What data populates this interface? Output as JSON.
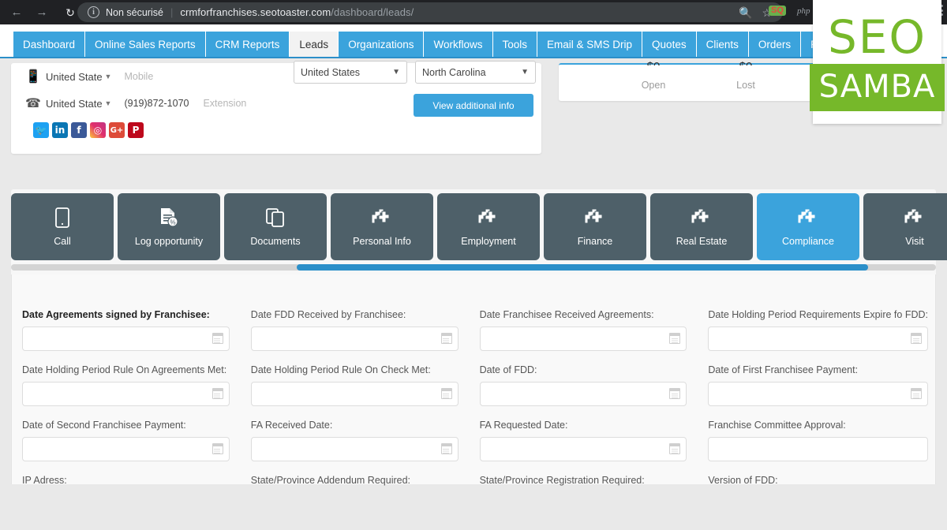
{
  "browser": {
    "back_icon": "back-arrow-icon",
    "forward_icon": "forward-arrow-icon",
    "reload_icon": "reload-icon",
    "security_label": "Non sécurisé",
    "url_host": "crmforfranchises.seotoaster.com",
    "url_path": "/dashboard/leads/",
    "search_icon": "search-icon",
    "bookmark_icon": "star-icon",
    "extension_badge": "SQ",
    "extension_php": "php",
    "menu_icon": "kebab-menu-icon"
  },
  "appnav": {
    "items": [
      {
        "label": "Dashboard",
        "active": false
      },
      {
        "label": "Online Sales Reports",
        "active": false
      },
      {
        "label": "CRM Reports",
        "active": false
      },
      {
        "label": "Leads",
        "active": true
      },
      {
        "label": "Organizations",
        "active": false
      },
      {
        "label": "Workflows",
        "active": false
      },
      {
        "label": "Tools",
        "active": false
      },
      {
        "label": "Email & SMS Drip",
        "active": false
      },
      {
        "label": "Quotes",
        "active": false
      },
      {
        "label": "Clients",
        "active": false
      },
      {
        "label": "Orders",
        "active": false
      },
      {
        "label": "Products",
        "active": false
      }
    ]
  },
  "contact": {
    "mobile_row": {
      "icon": "mobile-phone-icon",
      "country": "United State",
      "placeholder": "Mobile"
    },
    "phone_row": {
      "icon": "telephone-icon",
      "country": "United State",
      "number": "(919)872-1070",
      "extension_placeholder": "Extension"
    },
    "social": [
      {
        "name": "twitter-icon",
        "glyph": "🐦"
      },
      {
        "name": "linkedin-icon",
        "glyph": "in"
      },
      {
        "name": "facebook-icon",
        "glyph": "f"
      },
      {
        "name": "instagram-icon",
        "glyph": "◎"
      },
      {
        "name": "googleplus-icon",
        "glyph": "G+"
      },
      {
        "name": "pinterest-icon",
        "glyph": "P"
      }
    ]
  },
  "location": {
    "country": "United States",
    "state": "North Carolina",
    "view_additional_info": "View additional info"
  },
  "stats": {
    "open_label": "Open",
    "lost_label": "Lost"
  },
  "module_tabs": [
    {
      "label": "Call",
      "icon": "mobile-device-icon",
      "active": false
    },
    {
      "label": "Log opportunity",
      "icon": "document-percent-icon",
      "active": false
    },
    {
      "label": "Documents",
      "icon": "copy-documents-icon",
      "active": false
    },
    {
      "label": "Personal Info",
      "icon": "broken-image-icon",
      "active": false
    },
    {
      "label": "Employment",
      "icon": "broken-image-icon",
      "active": false
    },
    {
      "label": "Finance",
      "icon": "broken-image-icon",
      "active": false
    },
    {
      "label": "Real Estate",
      "icon": "broken-image-icon",
      "active": false
    },
    {
      "label": "Compliance",
      "icon": "broken-image-icon",
      "active": true
    },
    {
      "label": "Visit",
      "icon": "broken-image-icon",
      "active": false
    }
  ],
  "form_fields": [
    {
      "label": "Date Agreements signed by Franchisee:",
      "value": "",
      "calendar": true,
      "bold": true
    },
    {
      "label": "Date FDD Received by Franchisee:",
      "value": "",
      "calendar": true,
      "bold": false
    },
    {
      "label": "Date Franchisee Received Agreements:",
      "value": "",
      "calendar": true,
      "bold": false
    },
    {
      "label": "Date Holding Period Requirements Expire fo FDD:",
      "value": "",
      "calendar": true,
      "bold": false
    },
    {
      "label": "Date Holding Period Rule On Agreements Met:",
      "value": "",
      "calendar": true,
      "bold": false
    },
    {
      "label": "Date Holding Period Rule On Check Met:",
      "value": "",
      "calendar": true,
      "bold": false
    },
    {
      "label": "Date of FDD:",
      "value": "",
      "calendar": true,
      "bold": false
    },
    {
      "label": "Date of First Franchisee Payment:",
      "value": "",
      "calendar": true,
      "bold": false
    },
    {
      "label": "Date of Second Franchisee Payment:",
      "value": "",
      "calendar": true,
      "bold": false
    },
    {
      "label": "FA Received Date:",
      "value": "",
      "calendar": true,
      "bold": false
    },
    {
      "label": "FA Requested Date:",
      "value": "",
      "calendar": true,
      "bold": false
    },
    {
      "label": "Franchise Committee Approval:",
      "value": "",
      "calendar": false,
      "bold": false
    },
    {
      "label": "IP Adress:",
      "value": "",
      "calendar": false,
      "bold": false
    },
    {
      "label": "State/Province Addendum Required:",
      "value": "",
      "calendar": false,
      "bold": false
    },
    {
      "label": "State/Province Registration Required:",
      "value": "",
      "calendar": false,
      "bold": false
    },
    {
      "label": "Version of FDD:",
      "value": "",
      "calendar": false,
      "bold": false
    }
  ],
  "logo": {
    "top": "SEO",
    "bottom": "SAMBA",
    "color": "#76b82a"
  },
  "colors": {
    "nav_blue": "#3ba3dc",
    "tab_slate": "#4e6069",
    "page_bg": "#e9e9e9"
  }
}
